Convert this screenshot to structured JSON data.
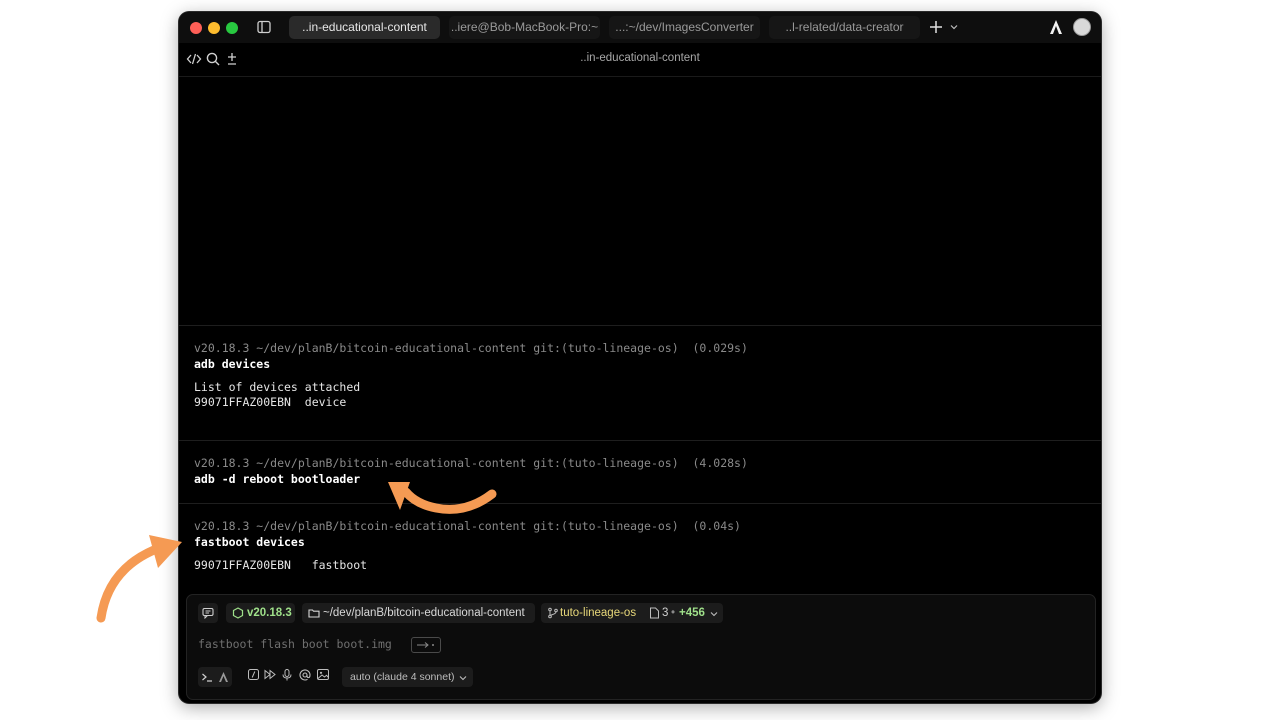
{
  "tabs": [
    {
      "label": "..in-educational-content",
      "active": true
    },
    {
      "label": "..iere@Bob-MacBook-Pro:~",
      "active": false
    },
    {
      "label": "...:~/dev/ImagesConverter",
      "active": false
    },
    {
      "label": "..l-related/data-creator",
      "active": false
    }
  ],
  "toolbar": {
    "title": "..in-educational-content"
  },
  "blocks": [
    {
      "meta": "v20.18.3 ~/dev/planB/bitcoin-educational-content git:(tuto-lineage-os)  (0.029s)",
      "command": "adb devices",
      "output": [
        "List of devices attached",
        "99071FFAZ00EBN  device"
      ]
    },
    {
      "meta": "v20.18.3 ~/dev/planB/bitcoin-educational-content git:(tuto-lineage-os)  (4.028s)",
      "command": "adb -d reboot bootloader",
      "output": []
    },
    {
      "meta": "v20.18.3 ~/dev/planB/bitcoin-educational-content git:(tuto-lineage-os)  (0.04s)",
      "command": "fastboot devices",
      "output": [
        "99071FFAZ00EBN   fastboot"
      ]
    }
  ],
  "input": {
    "node_version": "v20.18.3",
    "directory": "~/dev/planB/bitcoin-educational-content",
    "branch": "tuto-lineage-os",
    "changes_count": "3",
    "changes_added": "+456",
    "placeholder": "fastboot flash boot boot.img",
    "model": "auto (claude 4 sonnet)"
  },
  "colors": {
    "accent_green": "#9fe08a",
    "annotation_orange": "#f59a53"
  },
  "icons": [
    "code-icon",
    "search-icon",
    "plus-minus-icon",
    "sidebar-icon",
    "plus-icon",
    "chevron-down-icon",
    "warp-logo-icon",
    "avatar"
  ]
}
